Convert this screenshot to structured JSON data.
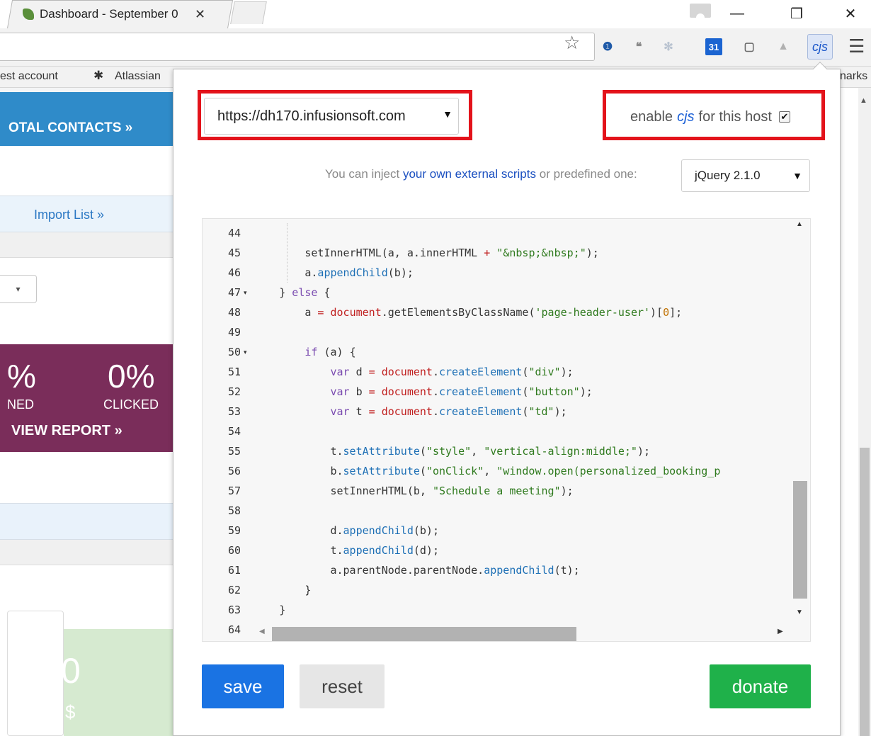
{
  "browser": {
    "tab_title": "Dashboard - September 0",
    "tab_close": "✕",
    "win_minimize": "—",
    "win_restore": "❐",
    "win_close": "✕",
    "star_glyph": "☆",
    "menu_glyph": "☰",
    "extensions": [
      {
        "name": "lastpass-icon",
        "glyph": "❶",
        "color": "#1f5aa8"
      },
      {
        "name": "hangouts-icon",
        "glyph": "❝",
        "color": "#8a8a8a"
      },
      {
        "name": "snowflake-icon",
        "glyph": "✻",
        "color": "#b9c3d0"
      },
      {
        "name": "calendar-icon",
        "glyph": "31",
        "color": "#1b64d1"
      },
      {
        "name": "square-icon",
        "glyph": "▢",
        "color": "#6b6b6b"
      },
      {
        "name": "drive-icon",
        "glyph": "▲",
        "color": "#b0b0b0"
      }
    ],
    "cjs_ext_label": "cjs",
    "bookmarks": [
      "est account",
      "Atlassian",
      "narks"
    ]
  },
  "background_page": {
    "contacts_label": "OTAL CONTACTS »",
    "import_link": "Import List »",
    "select_caret": "▾",
    "stat1_value": "%",
    "stat1_label": "NED",
    "stat2_value": "0%",
    "stat2_label": "CLICKED",
    "view_report": "VIEW REPORT »",
    "green_number": "0",
    "green_unit": "$"
  },
  "popup": {
    "host_value": "https://dh170.infusionsoft.com",
    "host_caret": "▼",
    "enable_prefix": "enable",
    "enable_cjs": "cjs",
    "enable_suffix": "for this host",
    "enable_checked": "✔",
    "inject_prefix": "You can inject",
    "inject_link": "your own external scripts",
    "inject_suffix": "or predefined one:",
    "library_value": "jQuery 2.1.0",
    "library_caret": "▼",
    "save_label": "save",
    "reset_label": "reset",
    "donate_label": "donate"
  },
  "editor": {
    "lines": [
      {
        "n": "44",
        "fold": false,
        "indent": 12,
        "tokens": []
      },
      {
        "n": "45",
        "fold": false,
        "indent": 12,
        "tokens": [
          [
            "def",
            "setInnerHTML(a, a.innerHTML "
          ],
          [
            "red",
            "+"
          ],
          [
            "def",
            " "
          ],
          [
            "str",
            "\"&nbsp;&nbsp;\""
          ],
          [
            "def",
            ");"
          ]
        ]
      },
      {
        "n": "46",
        "fold": false,
        "indent": 12,
        "tokens": [
          [
            "def",
            "a."
          ],
          [
            "fn",
            "appendChild"
          ],
          [
            "def",
            "(b);"
          ]
        ]
      },
      {
        "n": "47",
        "fold": true,
        "indent": 8,
        "tokens": [
          [
            "def",
            "} "
          ],
          [
            "kw",
            "else"
          ],
          [
            "def",
            " {"
          ]
        ]
      },
      {
        "n": "48",
        "fold": false,
        "indent": 12,
        "tokens": [
          [
            "def",
            "a "
          ],
          [
            "red",
            "="
          ],
          [
            "def",
            " "
          ],
          [
            "red",
            "document"
          ],
          [
            "def",
            ".getElementsByClassName("
          ],
          [
            "str",
            "'page-header-user'"
          ],
          [
            "def",
            ")["
          ],
          [
            "num",
            "0"
          ],
          [
            "def",
            "];"
          ]
        ]
      },
      {
        "n": "49",
        "fold": false,
        "indent": 12,
        "tokens": []
      },
      {
        "n": "50",
        "fold": true,
        "indent": 12,
        "tokens": [
          [
            "kw",
            "if"
          ],
          [
            "def",
            " (a) {"
          ]
        ]
      },
      {
        "n": "51",
        "fold": false,
        "indent": 16,
        "tokens": [
          [
            "kw",
            "var"
          ],
          [
            "def",
            " d "
          ],
          [
            "red",
            "="
          ],
          [
            "def",
            " "
          ],
          [
            "red",
            "document"
          ],
          [
            "def",
            "."
          ],
          [
            "fn",
            "createElement"
          ],
          [
            "def",
            "("
          ],
          [
            "str",
            "\"div\""
          ],
          [
            "def",
            ");"
          ]
        ]
      },
      {
        "n": "52",
        "fold": false,
        "indent": 16,
        "tokens": [
          [
            "kw",
            "var"
          ],
          [
            "def",
            " b "
          ],
          [
            "red",
            "="
          ],
          [
            "def",
            " "
          ],
          [
            "red",
            "document"
          ],
          [
            "def",
            "."
          ],
          [
            "fn",
            "createElement"
          ],
          [
            "def",
            "("
          ],
          [
            "str",
            "\"button\""
          ],
          [
            "def",
            ");"
          ]
        ]
      },
      {
        "n": "53",
        "fold": false,
        "indent": 16,
        "tokens": [
          [
            "kw",
            "var"
          ],
          [
            "def",
            " t "
          ],
          [
            "red",
            "="
          ],
          [
            "def",
            " "
          ],
          [
            "red",
            "document"
          ],
          [
            "def",
            "."
          ],
          [
            "fn",
            "createElement"
          ],
          [
            "def",
            "("
          ],
          [
            "str",
            "\"td\""
          ],
          [
            "def",
            ");"
          ]
        ]
      },
      {
        "n": "54",
        "fold": false,
        "indent": 16,
        "tokens": []
      },
      {
        "n": "55",
        "fold": false,
        "indent": 16,
        "tokens": [
          [
            "def",
            "t."
          ],
          [
            "fn",
            "setAttribute"
          ],
          [
            "def",
            "("
          ],
          [
            "str",
            "\"style\""
          ],
          [
            "def",
            ", "
          ],
          [
            "str",
            "\"vertical-align:middle;\""
          ],
          [
            "def",
            ");"
          ]
        ]
      },
      {
        "n": "56",
        "fold": false,
        "indent": 16,
        "tokens": [
          [
            "def",
            "b."
          ],
          [
            "fn",
            "setAttribute"
          ],
          [
            "def",
            "("
          ],
          [
            "str",
            "\"onClick\""
          ],
          [
            "def",
            ", "
          ],
          [
            "str",
            "\"window.open(personalized_booking_p"
          ]
        ]
      },
      {
        "n": "57",
        "fold": false,
        "indent": 16,
        "tokens": [
          [
            "def",
            "setInnerHTML(b, "
          ],
          [
            "str",
            "\"Schedule a meeting\""
          ],
          [
            "def",
            ");"
          ]
        ]
      },
      {
        "n": "58",
        "fold": false,
        "indent": 16,
        "tokens": []
      },
      {
        "n": "59",
        "fold": false,
        "indent": 16,
        "tokens": [
          [
            "def",
            "d."
          ],
          [
            "fn",
            "appendChild"
          ],
          [
            "def",
            "(b);"
          ]
        ]
      },
      {
        "n": "60",
        "fold": false,
        "indent": 16,
        "tokens": [
          [
            "def",
            "t."
          ],
          [
            "fn",
            "appendChild"
          ],
          [
            "def",
            "(d);"
          ]
        ]
      },
      {
        "n": "61",
        "fold": false,
        "indent": 16,
        "tokens": [
          [
            "def",
            "a.parentNode.parentNode."
          ],
          [
            "fn",
            "appendChild"
          ],
          [
            "def",
            "(t);"
          ]
        ]
      },
      {
        "n": "62",
        "fold": false,
        "indent": 12,
        "tokens": [
          [
            "def",
            "}"
          ]
        ]
      },
      {
        "n": "63",
        "fold": false,
        "indent": 8,
        "tokens": [
          [
            "def",
            "}"
          ]
        ]
      },
      {
        "n": "64",
        "fold": false,
        "indent": 8,
        "tokens": []
      }
    ]
  }
}
